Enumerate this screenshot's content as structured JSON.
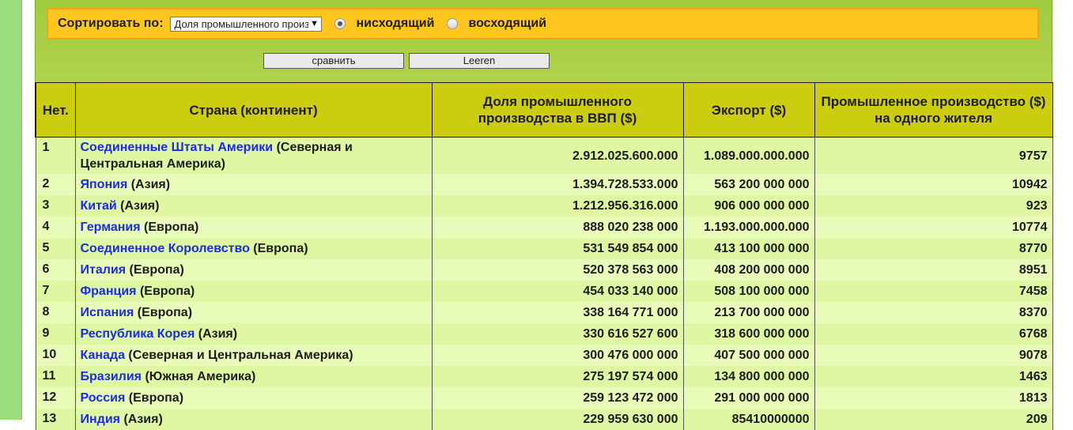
{
  "sort": {
    "label": "Сортировать по:",
    "selected": "Доля промышленного производства в ВВП ($)",
    "desc_label": "нисходящий",
    "asc_label": "восходящий"
  },
  "buttons": {
    "compare": "сравнить",
    "clear": "Leeren"
  },
  "table": {
    "headers": [
      "Нет.",
      "Страна (континент)",
      "Доля промышленного производства в ВВП ($)",
      "Экспорт ($)",
      "Промышленное производство ($) на одного жителя"
    ],
    "rows": [
      {
        "n": "1",
        "country": "Соединенные Штаты Америки",
        "continent": " (Северная и Центральная Америка)",
        "share": "2.912.025.600.000",
        "export": "1.089.000.000.000",
        "per": "9757"
      },
      {
        "n": "2",
        "country": "Япония",
        "continent": " (Азия)",
        "share": "1.394.728.533.000",
        "export": "563 200 000 000",
        "per": "10942"
      },
      {
        "n": "3",
        "country": "Китай",
        "continent": " (Азия)",
        "share": "1.212.956.316.000",
        "export": "906 000 000 000",
        "per": "923"
      },
      {
        "n": "4",
        "country": "Германия",
        "continent": " (Европа)",
        "share": "888 020 238 000",
        "export": "1.193.000.000.000",
        "per": "10774"
      },
      {
        "n": "5",
        "country": "Соединенное Королевство",
        "continent": " (Европа)",
        "share": "531 549 854 000",
        "export": "413 100 000 000",
        "per": "8770"
      },
      {
        "n": "6",
        "country": "Италия",
        "continent": " (Европа)",
        "share": "520 378 563 000",
        "export": "408 200 000 000",
        "per": "8951"
      },
      {
        "n": "7",
        "country": "Франция",
        "continent": " (Европа)",
        "share": "454 033 140 000",
        "export": "508 100 000 000",
        "per": "7458"
      },
      {
        "n": "8",
        "country": "Испания",
        "continent": " (Европа)",
        "share": "338 164 771 000",
        "export": "213 700 000 000",
        "per": "8370"
      },
      {
        "n": "9",
        "country": "Республика Корея",
        "continent": " (Азия)",
        "share": "330 616 527 600",
        "export": "318 600 000 000",
        "per": "6768"
      },
      {
        "n": "10",
        "country": "Канада",
        "continent": " (Северная и Центральная Америка)",
        "share": "300 476 000 000",
        "export": "407 500 000 000",
        "per": "9078"
      },
      {
        "n": "11",
        "country": "Бразилия",
        "continent": " (Южная Америка)",
        "share": "275 197 574 000",
        "export": "134 800 000 000",
        "per": "1463"
      },
      {
        "n": "12",
        "country": "Россия",
        "continent": " (Европа)",
        "share": "259 123 472 000",
        "export": "291 000 000 000",
        "per": "1813"
      },
      {
        "n": "13",
        "country": "Индия",
        "continent": " (Азия)",
        "share": "229 959 630 000",
        "export": "85410000000",
        "per": "209"
      }
    ]
  }
}
